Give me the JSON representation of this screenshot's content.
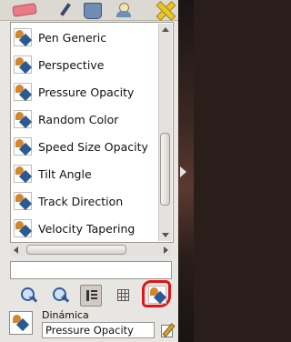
{
  "toolbar": {
    "icons": [
      "eraser-icon",
      "pen-tool-icon",
      "bucket-icon",
      "user-icon",
      "close-icon"
    ]
  },
  "dynamics_list": {
    "items": [
      {
        "label": "Pen Generic"
      },
      {
        "label": "Perspective"
      },
      {
        "label": "Pressure Opacity"
      },
      {
        "label": "Random Color"
      },
      {
        "label": "Speed Size Opacity"
      },
      {
        "label": "Tilt Angle"
      },
      {
        "label": "Track Direction"
      },
      {
        "label": "Velocity Tapering"
      }
    ]
  },
  "filter": {
    "value": ""
  },
  "bottom_toolbar": {
    "buttons": [
      "zoom-out",
      "zoom-in",
      "view-as-list",
      "view-as-grid",
      "open-dynamics"
    ],
    "zoom_out_sign": "−",
    "zoom_in_sign": "+"
  },
  "footer": {
    "label": "Dinámica",
    "value": "Pressure Opacity"
  },
  "colors": {
    "highlight_circle": "#e01616",
    "panel_bg": "#e8e6e2"
  }
}
